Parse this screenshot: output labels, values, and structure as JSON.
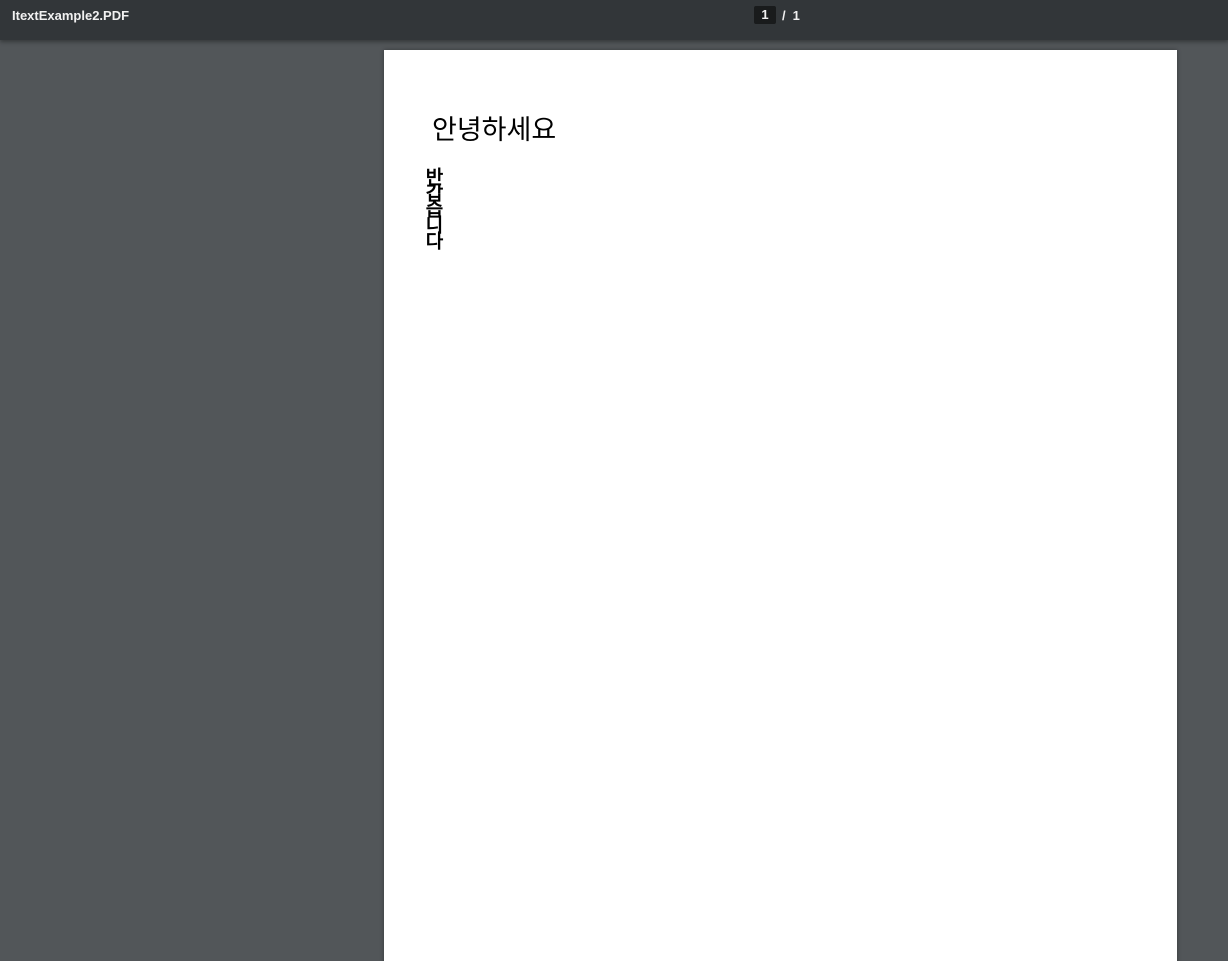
{
  "toolbar": {
    "title": "ItextExample2.PDF",
    "current_page": "1",
    "separator": "/",
    "total_pages": "1"
  },
  "document": {
    "greeting": "안녕하세요",
    "vertical_text": "반갑습니다"
  },
  "colors": {
    "toolbar_bg": "#323639",
    "viewer_bg": "#525659",
    "page_bg": "#ffffff",
    "text": "#000000"
  }
}
